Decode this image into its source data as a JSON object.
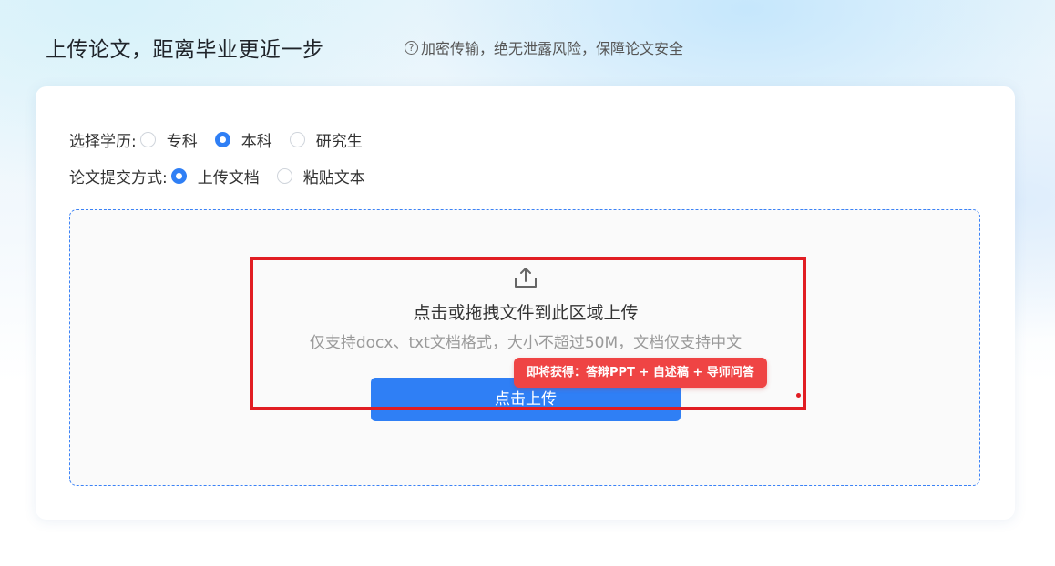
{
  "header": {
    "title": "上传论文，距离毕业更近一步",
    "security_note": "加密传输，绝无泄露风险，保障论文安全",
    "help_icon": "question-circle-icon"
  },
  "form": {
    "degree": {
      "label": "选择学历:",
      "options": [
        "专科",
        "本科",
        "研究生"
      ],
      "selected": "本科"
    },
    "submit_method": {
      "label": "论文提交方式:",
      "options": [
        "上传文档",
        "粘贴文本"
      ],
      "selected": "上传文档"
    }
  },
  "upload": {
    "icon": "upload-icon",
    "title": "点击或拖拽文件到此区域上传",
    "hint": "仅支持docx、txt文档格式，大小不超过50M，文档仅支持中文",
    "button_label": "点击上传",
    "promo_badge": "即将获得：答辩PPT + 自述稿 + 导师问答"
  },
  "colors": {
    "accent": "#2f7ff5",
    "promo": "#ef4444",
    "highlight": "#e11d23"
  }
}
